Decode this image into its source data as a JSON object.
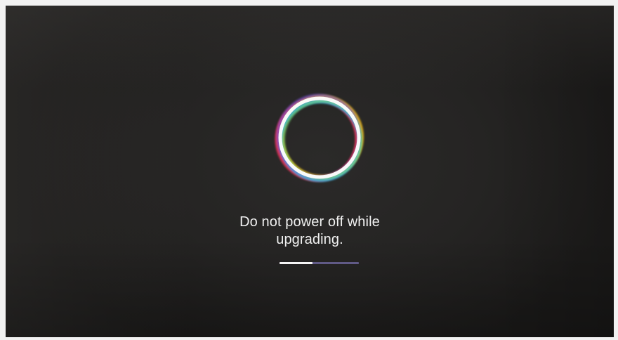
{
  "screen": {
    "message_line1": "Do not power off while",
    "message_line2": "upgrading.",
    "spinner_icon": "rainbow-ring-icon",
    "progress": {
      "fraction": 0.42,
      "fill_color": "#f4f4f4",
      "track_color": "#605a86"
    },
    "colors": {
      "background": "#252423",
      "text": "#f1f1f1",
      "ring_accents": [
        "#e9365b",
        "#f6c21a",
        "#7ee06a",
        "#35b7e8",
        "#7a53d8",
        "#ffffff"
      ]
    }
  }
}
